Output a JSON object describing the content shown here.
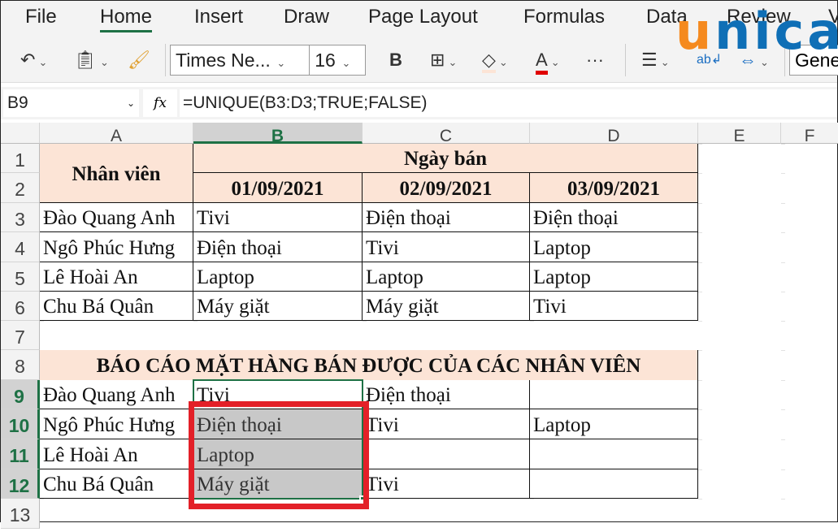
{
  "ribbon": {
    "tabs": [
      "File",
      "Home",
      "Insert",
      "Draw",
      "Page Layout",
      "Formulas",
      "Data",
      "Review",
      "V"
    ],
    "active_tab": "Home"
  },
  "toolbar": {
    "font_name": "Times Ne...",
    "font_size": "16",
    "bold_label": "B",
    "font_color_label": "A",
    "more_label": "···",
    "number_format": "Gene",
    "font_color": "#e00000",
    "fill_color": "#fce4d6"
  },
  "logo": {
    "text": "unica",
    "colors": [
      "#f58a1f",
      "#0f6fb6"
    ]
  },
  "formula_bar": {
    "name_box": "B9",
    "fx_label": "fx",
    "formula": "=UNIQUE(B3:D3;TRUE;FALSE)"
  },
  "columns": [
    "A",
    "B",
    "C",
    "D",
    "E",
    "F"
  ],
  "rows": [
    "1",
    "2",
    "3",
    "4",
    "5",
    "6",
    "7",
    "8",
    "9",
    "10",
    "11",
    "12",
    "13"
  ],
  "sheet": {
    "header_employee": "Nhân viên",
    "header_sale_date": "Ngày bán",
    "dates": [
      "01/09/2021",
      "02/09/2021",
      "03/09/2021"
    ],
    "data": [
      [
        "Đào Quang Anh",
        "Tivi",
        "Điện thoại",
        "Điện thoại"
      ],
      [
        "Ngô Phúc Hưng",
        "Điện thoại",
        "Tivi",
        "Laptop"
      ],
      [
        "Lê Hoài An",
        "Laptop",
        "Laptop",
        "Laptop"
      ],
      [
        "Chu Bá Quân",
        "Máy giặt",
        "Máy giặt",
        "Tivi"
      ]
    ],
    "report_title": "BÁO CÁO MẶT HÀNG BÁN ĐƯỢC CỦA CÁC NHÂN VIÊN",
    "report": [
      [
        "Đào Quang Anh",
        "Tivi",
        "Điện thoại",
        ""
      ],
      [
        "Ngô Phúc Hưng",
        "Điện thoại",
        "Tivi",
        "Laptop"
      ],
      [
        "Lê Hoài An",
        "Laptop",
        "",
        ""
      ],
      [
        "Chu Bá Quân",
        "Máy giặt",
        "Tivi",
        ""
      ]
    ]
  },
  "selection": {
    "active_cell": "B9",
    "range": "B9:B12"
  }
}
